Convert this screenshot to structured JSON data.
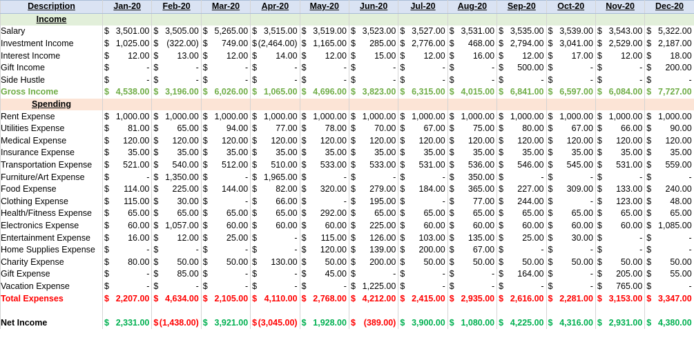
{
  "months": [
    "Jan-20",
    "Feb-20",
    "Mar-20",
    "Apr-20",
    "May-20",
    "Jun-20",
    "Jul-20",
    "Aug-20",
    "Sep-20",
    "Oct-20",
    "Nov-20",
    "Dec-20"
  ],
  "header_label": "Description",
  "income_section": "Income",
  "spending_section": "Spending",
  "income_rows": [
    {
      "label": "Salary",
      "values": [
        "3,501.00",
        "3,505.00",
        "5,265.00",
        "3,515.00",
        "3,519.00",
        "3,523.00",
        "3,527.00",
        "3,531.00",
        "3,535.00",
        "3,539.00",
        "3,543.00",
        "5,322.00"
      ]
    },
    {
      "label": "Investment Income",
      "values": [
        "1,025.00",
        "(322.00)",
        "749.00",
        "(2,464.00)",
        "1,165.00",
        "285.00",
        "2,776.00",
        "468.00",
        "2,794.00",
        "3,041.00",
        "2,529.00",
        "2,187.00"
      ]
    },
    {
      "label": "Interest Income",
      "values": [
        "12.00",
        "13.00",
        "12.00",
        "14.00",
        "12.00",
        "15.00",
        "12.00",
        "16.00",
        "12.00",
        "17.00",
        "12.00",
        "18.00"
      ]
    },
    {
      "label": "Gift Income",
      "values": [
        "-",
        "-",
        "-",
        "-",
        "-",
        "-",
        "-",
        "-",
        "500.00",
        "-",
        "-",
        "200.00"
      ]
    },
    {
      "label": "Side Hustle",
      "values": [
        "-",
        "-",
        "-",
        "-",
        "-",
        "-",
        "-",
        "-",
        "-",
        "-",
        "-",
        "-"
      ]
    }
  ],
  "gross_income": {
    "label": "Gross Income",
    "values": [
      "4,538.00",
      "3,196.00",
      "6,026.00",
      "1,065.00",
      "4,696.00",
      "3,823.00",
      "6,315.00",
      "4,015.00",
      "6,841.00",
      "6,597.00",
      "6,084.00",
      "7,727.00"
    ]
  },
  "spending_rows": [
    {
      "label": "Rent Expense",
      "values": [
        "1,000.00",
        "1,000.00",
        "1,000.00",
        "1,000.00",
        "1,000.00",
        "1,000.00",
        "1,000.00",
        "1,000.00",
        "1,000.00",
        "1,000.00",
        "1,000.00",
        "1,000.00"
      ]
    },
    {
      "label": "Utilities Expense",
      "values": [
        "81.00",
        "65.00",
        "94.00",
        "77.00",
        "78.00",
        "70.00",
        "67.00",
        "75.00",
        "80.00",
        "67.00",
        "66.00",
        "90.00"
      ]
    },
    {
      "label": "Medical Expense",
      "values": [
        "120.00",
        "120.00",
        "120.00",
        "120.00",
        "120.00",
        "120.00",
        "120.00",
        "120.00",
        "120.00",
        "120.00",
        "120.00",
        "120.00"
      ]
    },
    {
      "label": "Insurance Expense",
      "values": [
        "35.00",
        "35.00",
        "35.00",
        "35.00",
        "35.00",
        "35.00",
        "35.00",
        "35.00",
        "35.00",
        "35.00",
        "35.00",
        "35.00"
      ]
    },
    {
      "label": "Transportation Expense",
      "values": [
        "521.00",
        "540.00",
        "512.00",
        "510.00",
        "533.00",
        "533.00",
        "531.00",
        "536.00",
        "546.00",
        "545.00",
        "531.00",
        "559.00"
      ]
    },
    {
      "label": "Furniture/Art Expense",
      "values": [
        "-",
        "1,350.00",
        "-",
        "1,965.00",
        "-",
        "-",
        "-",
        "350.00",
        "-",
        "-",
        "-",
        "-"
      ]
    },
    {
      "label": "Food Expense",
      "values": [
        "114.00",
        "225.00",
        "144.00",
        "82.00",
        "320.00",
        "279.00",
        "184.00",
        "365.00",
        "227.00",
        "309.00",
        "133.00",
        "240.00"
      ]
    },
    {
      "label": "Clothing Expense",
      "values": [
        "115.00",
        "30.00",
        "-",
        "66.00",
        "-",
        "195.00",
        "-",
        "77.00",
        "244.00",
        "-",
        "123.00",
        "48.00"
      ]
    },
    {
      "label": "Health/Fitness Expense",
      "values": [
        "65.00",
        "65.00",
        "65.00",
        "65.00",
        "292.00",
        "65.00",
        "65.00",
        "65.00",
        "65.00",
        "65.00",
        "65.00",
        "65.00"
      ]
    },
    {
      "label": "Electronics Expense",
      "values": [
        "60.00",
        "1,057.00",
        "60.00",
        "60.00",
        "60.00",
        "225.00",
        "60.00",
        "60.00",
        "60.00",
        "60.00",
        "60.00",
        "1,085.00"
      ]
    },
    {
      "label": "Entertainment Expense",
      "values": [
        "16.00",
        "12.00",
        "25.00",
        "-",
        "115.00",
        "126.00",
        "103.00",
        "135.00",
        "25.00",
        "30.00",
        "-",
        "-"
      ]
    },
    {
      "label": "Home Supplies Expense",
      "values": [
        "-",
        "-",
        "-",
        "-",
        "120.00",
        "139.00",
        "200.00",
        "67.00",
        "-",
        "-",
        "-",
        "-"
      ]
    },
    {
      "label": "Charity Expense",
      "values": [
        "80.00",
        "50.00",
        "50.00",
        "130.00",
        "50.00",
        "200.00",
        "50.00",
        "50.00",
        "50.00",
        "50.00",
        "50.00",
        "50.00"
      ]
    },
    {
      "label": "Gift Expense",
      "values": [
        "-",
        "85.00",
        "-",
        "-",
        "45.00",
        "-",
        "-",
        "-",
        "164.00",
        "-",
        "205.00",
        "55.00"
      ]
    },
    {
      "label": "Vacation Expense",
      "values": [
        "-",
        "-",
        "-",
        "-",
        "-",
        "1,225.00",
        "-",
        "-",
        "-",
        "-",
        "765.00",
        "-"
      ]
    }
  ],
  "total_expenses": {
    "label": "Total Expenses",
    "values": [
      "2,207.00",
      "4,634.00",
      "2,105.00",
      "4,110.00",
      "2,768.00",
      "4,212.00",
      "2,415.00",
      "2,935.00",
      "2,616.00",
      "2,281.00",
      "3,153.00",
      "3,347.00"
    ]
  },
  "net_income": {
    "label": "Net Income",
    "values": [
      "2,331.00",
      "(1,438.00)",
      "3,921.00",
      "(3,045.00)",
      "1,928.00",
      "(389.00)",
      "3,900.00",
      "1,080.00",
      "4,225.00",
      "4,316.00",
      "2,931.00",
      "4,380.00"
    ]
  },
  "currency_symbol": "$",
  "colors": {
    "header_bg": "#dae3f3",
    "income_bg": "#e2efda",
    "spending_bg": "#fce4d6",
    "gross": "#70ad47",
    "total": "#ff0000",
    "net_positive": "#00b050",
    "net_negative": "#ff0000"
  }
}
